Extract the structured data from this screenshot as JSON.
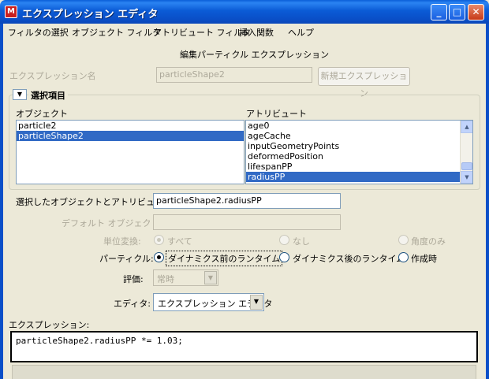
{
  "window": {
    "title": "エクスプレッション エディタ",
    "icon_glyph": "M",
    "min_glyph": "_",
    "max_glyph": "□",
    "close_glyph": "✕"
  },
  "menu": [
    "フィルタの選択",
    "オブジェクト フィルタ",
    "アトリビュート フィルタ",
    "挿入関数",
    "ヘルプ"
  ],
  "header": {
    "mode_title": "編集パーティクル エクスプレッション",
    "expr_name_label": "エクスプレッション名",
    "expr_name_value": "particleShape2",
    "new_expr_button": "新規エクスプレッション"
  },
  "selection": {
    "section_title": "選択項目",
    "collapse_glyph": "▼",
    "objects_label": "オブジェクト",
    "objects": [
      {
        "label": "particle2",
        "selected": false
      },
      {
        "label": "particleShape2",
        "selected": true
      }
    ],
    "attributes_label": "アトリビュート",
    "attributes": [
      {
        "label": "age0",
        "selected": false
      },
      {
        "label": "ageCache",
        "selected": false
      },
      {
        "label": "inputGeometryPoints",
        "selected": false
      },
      {
        "label": "deformedPosition",
        "selected": false
      },
      {
        "label": "lifespanPP",
        "selected": false
      },
      {
        "label": "radiusPP",
        "selected": true
      }
    ],
    "scroll_up_glyph": "▲",
    "scroll_down_glyph": "▼"
  },
  "form": {
    "selected_obj_attr_label": "選択したオブジェクトとアトリビュート:",
    "selected_obj_attr_value": "particleShape2.radiusPP",
    "default_object_label": "デフォルト オブジェクト:",
    "default_object_value": "",
    "unit_conversion_label": "単位変換:",
    "unit_options": [
      {
        "label": "すべて",
        "checked": true
      },
      {
        "label": "なし",
        "checked": false
      },
      {
        "label": "角度のみ",
        "checked": false
      }
    ],
    "particle_label": "パーティクル:",
    "particle_options": [
      {
        "label": "ダイナミクス前のランタイム",
        "checked": true
      },
      {
        "label": "ダイナミクス後のランタイム",
        "checked": false
      },
      {
        "label": "作成時",
        "checked": false
      }
    ],
    "evaluation_label": "評価:",
    "evaluation_value": "常時",
    "editor_label": "エディタ:",
    "editor_value": "エクスプレッション エディタ",
    "dropdown_glyph": "▼"
  },
  "expression": {
    "label": "エクスプレッション:",
    "code": "particleShape2.radiusPP *= 1.03;"
  }
}
